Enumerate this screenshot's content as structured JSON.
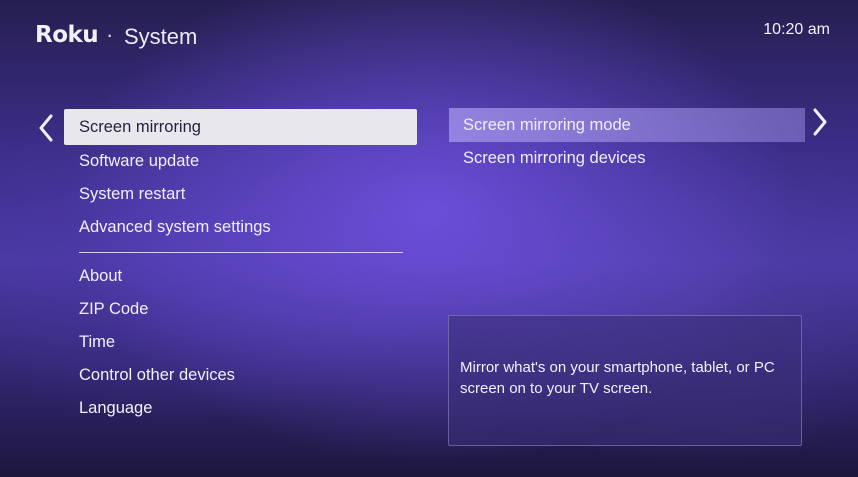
{
  "header": {
    "logo_text": "Roku",
    "separator": "·",
    "title": "System",
    "clock": "10:20 am"
  },
  "navigation": {
    "left_arrow_icon": "chevron-left-icon",
    "right_arrow_icon": "chevron-right-icon"
  },
  "left_menu": {
    "selected_index": 0,
    "group1": [
      {
        "label": "Screen mirroring"
      },
      {
        "label": "Software update"
      },
      {
        "label": "System restart"
      },
      {
        "label": "Advanced system settings"
      }
    ],
    "group2": [
      {
        "label": "About"
      },
      {
        "label": "ZIP Code"
      },
      {
        "label": "Time"
      },
      {
        "label": "Control other devices"
      },
      {
        "label": "Language"
      }
    ]
  },
  "right_menu": {
    "highlighted_index": 0,
    "items": [
      {
        "label": "Screen mirroring mode"
      },
      {
        "label": "Screen mirroring devices"
      }
    ]
  },
  "description": {
    "text": "Mirror what's on your smartphone, tablet, or PC screen on to your TV screen."
  },
  "colors": {
    "background_accent": "#4a39a3",
    "selected_item_bg": "#e8e7ee",
    "highlight_bg": "#aa9cee"
  }
}
